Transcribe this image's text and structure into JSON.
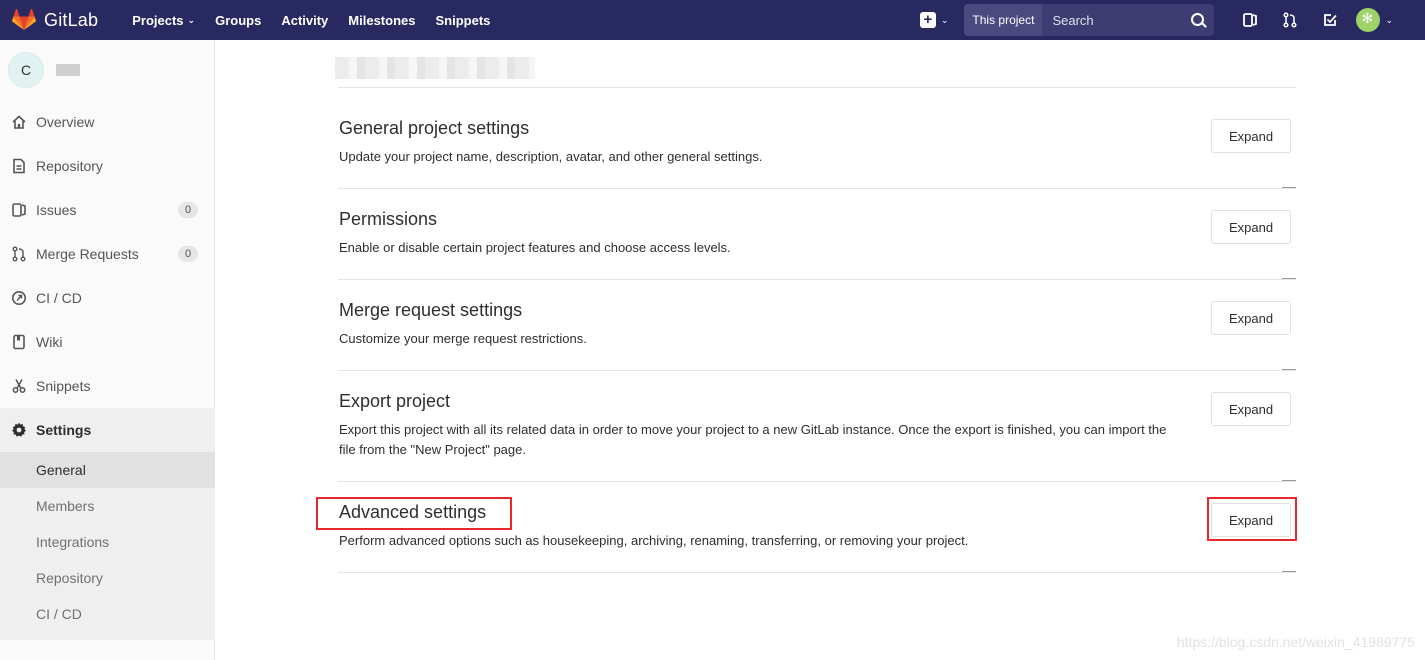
{
  "app": {
    "name": "GitLab"
  },
  "topnav": {
    "links": [
      {
        "label": "Projects",
        "has_dropdown": true
      },
      {
        "label": "Groups"
      },
      {
        "label": "Activity"
      },
      {
        "label": "Milestones"
      },
      {
        "label": "Snippets"
      }
    ],
    "search": {
      "scope": "This project",
      "placeholder": "Search"
    }
  },
  "sidebar": {
    "project_avatar_letter": "C",
    "items": [
      {
        "label": "Overview",
        "icon": "home-icon"
      },
      {
        "label": "Repository",
        "icon": "document-icon"
      },
      {
        "label": "Issues",
        "icon": "issues-icon",
        "badge": "0"
      },
      {
        "label": "Merge Requests",
        "icon": "merge-request-icon",
        "badge": "0"
      },
      {
        "label": "CI / CD",
        "icon": "rocket-icon"
      },
      {
        "label": "Wiki",
        "icon": "book-icon"
      },
      {
        "label": "Snippets",
        "icon": "scissors-icon"
      },
      {
        "label": "Settings",
        "icon": "gear-icon",
        "active": true
      }
    ],
    "settings_submenu": [
      {
        "label": "General",
        "active": true
      },
      {
        "label": "Members"
      },
      {
        "label": "Integrations"
      },
      {
        "label": "Repository"
      },
      {
        "label": "CI / CD"
      }
    ]
  },
  "main": {
    "sections": [
      {
        "title": "General project settings",
        "description": "Update your project name, description, avatar, and other general settings.",
        "button": "Expand"
      },
      {
        "title": "Permissions",
        "description": "Enable or disable certain project features and choose access levels.",
        "button": "Expand"
      },
      {
        "title": "Merge request settings",
        "description": "Customize your merge request restrictions.",
        "button": "Expand"
      },
      {
        "title": "Export project",
        "description": "Export this project with all its related data in order to move your project to a new GitLab instance. Once the export is finished, you can import the file from the \"New Project\" page.",
        "button": "Expand"
      },
      {
        "title": "Advanced settings",
        "description": "Perform advanced options such as housekeeping, archiving, renaming, transferring, or removing your project.",
        "button": "Expand"
      }
    ]
  },
  "colors": {
    "topbar": "#292961",
    "highlight": "#e8272c",
    "logo": "#e24329"
  },
  "watermark": "https://blog.csdn.net/weixin_41989775"
}
